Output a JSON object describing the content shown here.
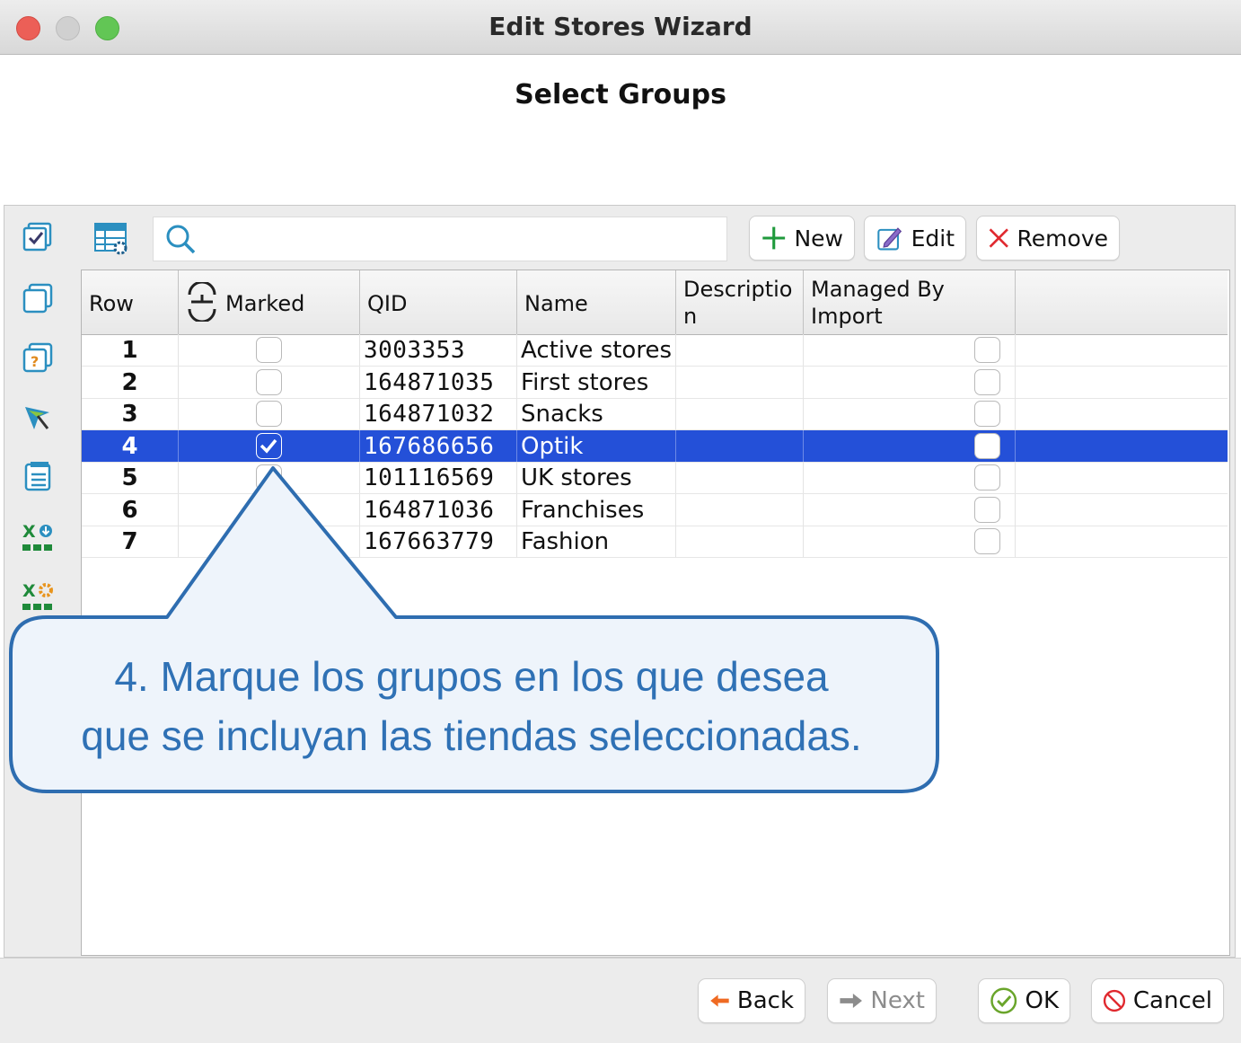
{
  "window": {
    "title": "Edit Stores Wizard"
  },
  "page_title": "Select Groups",
  "toolbar": {
    "new_label": "New",
    "edit_label": "Edit",
    "remove_label": "Remove",
    "search_value": ""
  },
  "side_tools": [
    "check-list-icon",
    "duplicate-icon",
    "help-copy-icon",
    "cursor-select-icon",
    "clipboard-list-icon",
    "export-excel-icon",
    "excel-settings-icon"
  ],
  "table": {
    "headers": {
      "row": "Row",
      "marked": "Marked",
      "qid": "QID",
      "name": "Name",
      "description_1": "Descriptio",
      "description_2": "n",
      "managed_1": "Managed By",
      "managed_2": "Import"
    },
    "rows": [
      {
        "row": "1",
        "qid": "3003353",
        "name": "Active stores",
        "marked": false,
        "managed": false
      },
      {
        "row": "2",
        "qid": "164871035",
        "name": "First stores",
        "marked": false,
        "managed": false
      },
      {
        "row": "3",
        "qid": "164871032",
        "name": "Snacks",
        "marked": false,
        "managed": false
      },
      {
        "row": "4",
        "qid": "167686656",
        "name": "Optik",
        "marked": true,
        "managed": false,
        "selected": true
      },
      {
        "row": "5",
        "qid": "101116569",
        "name": "UK stores",
        "marked": false,
        "managed": false
      },
      {
        "row": "6",
        "qid": "164871036",
        "name": "Franchises",
        "marked": false,
        "managed": false
      },
      {
        "row": "7",
        "qid": "167663779",
        "name": "Fashion",
        "marked": false,
        "managed": false
      }
    ]
  },
  "callout": {
    "line1": "4. Marque los grupos en los que desea",
    "line2": "que se incluyan las tiendas seleccionadas."
  },
  "footer": {
    "back_label": "Back",
    "next_label": "Next",
    "ok_label": "OK",
    "cancel_label": "Cancel"
  },
  "colors": {
    "selection": "#2450d8",
    "callout_text": "#2f71b5",
    "callout_border": "#2e6db0",
    "callout_fill": "#eef4fb"
  }
}
